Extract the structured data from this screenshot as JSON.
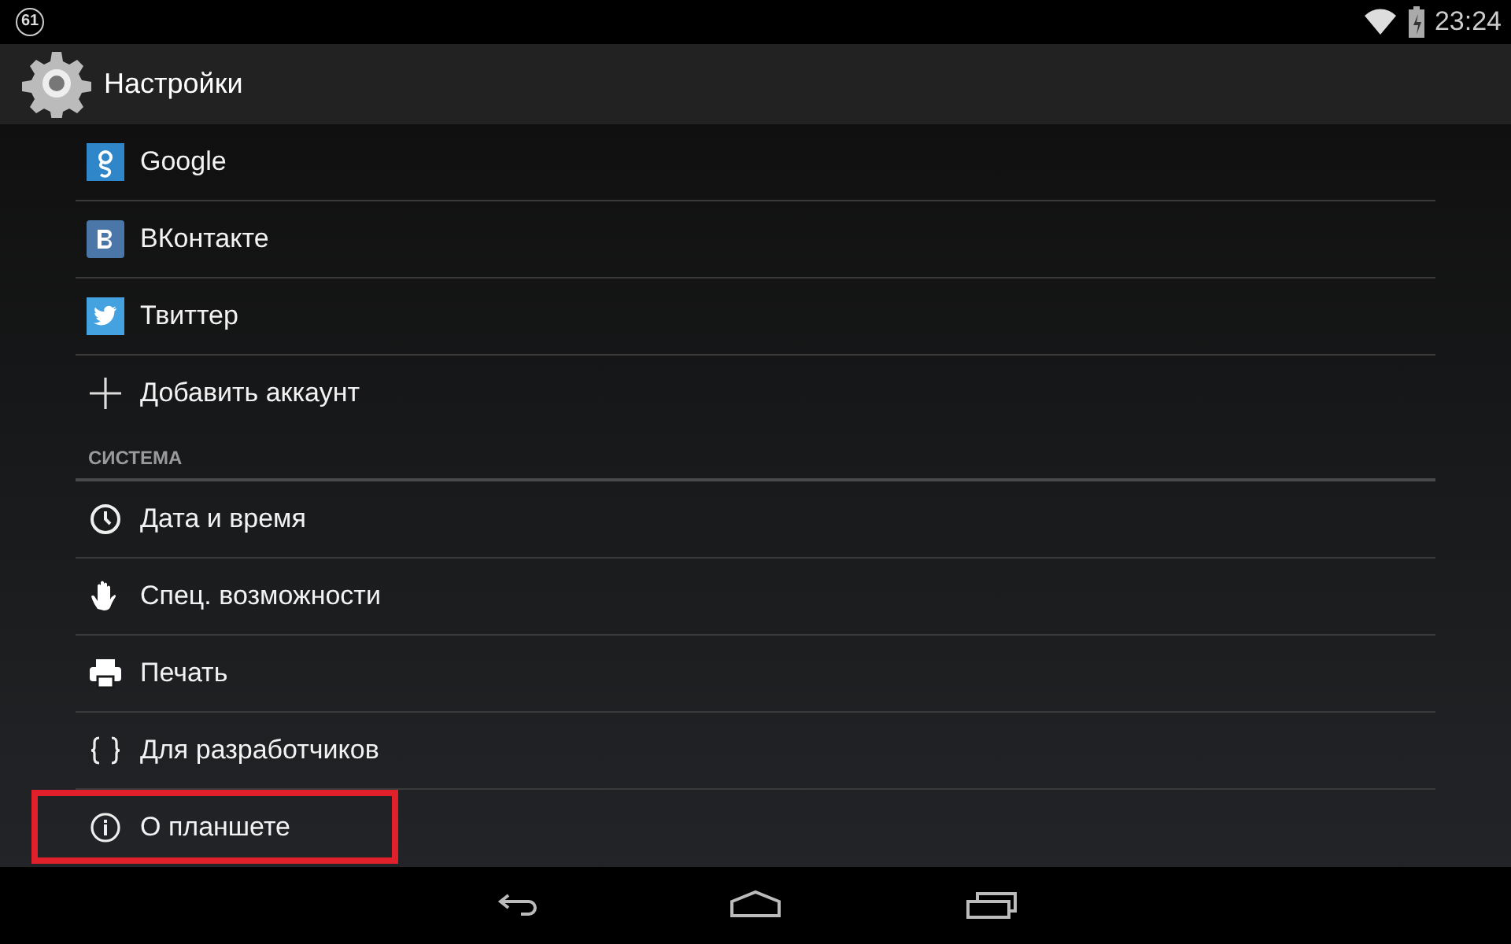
{
  "status_bar": {
    "notification_count": "61",
    "time": "23:24"
  },
  "action_bar": {
    "title": "Настройки"
  },
  "accounts": [
    {
      "label": "Google",
      "highlighted": false
    },
    {
      "label": "ВКонтакте",
      "highlighted": false
    },
    {
      "label": "Твиттер",
      "highlighted": false
    },
    {
      "label": "Добавить аккаунт",
      "highlighted": false
    }
  ],
  "system": {
    "header": "СИСТЕМА",
    "items": [
      {
        "label": "Дата и время",
        "highlighted": false
      },
      {
        "label": "Спец. возможности",
        "highlighted": false
      },
      {
        "label": "Печать",
        "highlighted": false
      },
      {
        "label": "Для разработчиков",
        "highlighted": false
      },
      {
        "label": "О планшете",
        "highlighted": true
      }
    ]
  }
}
